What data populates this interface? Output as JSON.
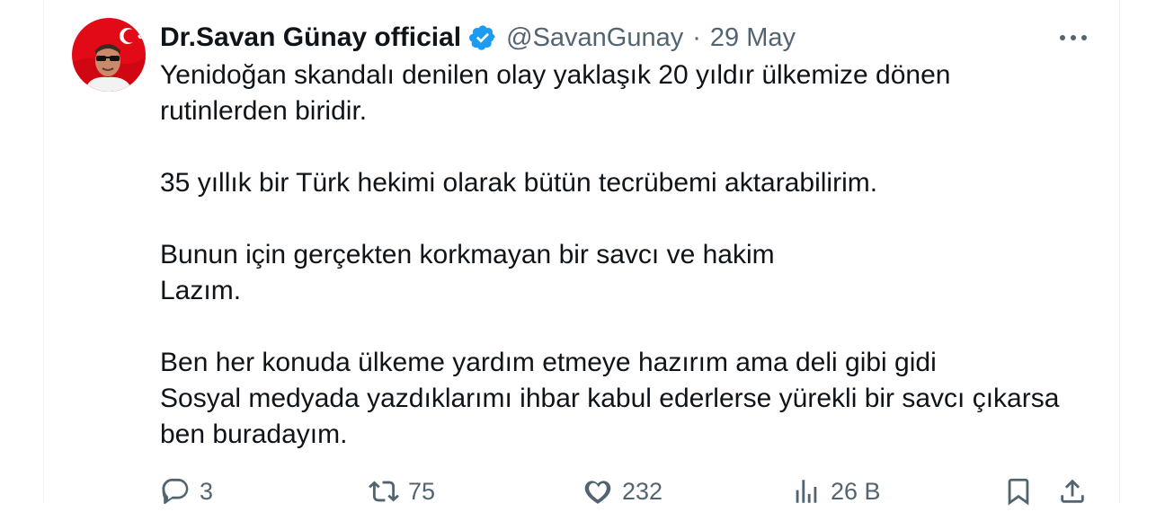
{
  "author": {
    "display_name": "Dr.Savan Günay official",
    "handle": "@SavanGunay",
    "date": "29 May",
    "verified": true,
    "verified_color": "#1d9bf0"
  },
  "tweet": {
    "lines": [
      "Yenidoğan skandalı denilen olay yaklaşık 20 yıldır ülkemize dönen",
      "rutinlerden biridir.",
      "35 yıllık bir Türk hekimi olarak bütün tecrübemi aktarabilirim.",
      "Bunun için gerçekten korkmayan bir savcı ve hakim",
      "Lazım.",
      "Ben her konuda ülkeme yardım etmeye hazırım ama deli gibi gidi",
      "Sosyal medyada yazdıklarımı ihbar kabul ederlerse yürekli bir savcı çıkarsa",
      "ben buradayım."
    ]
  },
  "actions": {
    "reply": {
      "icon": "reply-icon",
      "count": "3"
    },
    "retweet": {
      "icon": "retweet-icon",
      "count": "75"
    },
    "like": {
      "icon": "heart-icon",
      "count": "232"
    },
    "views": {
      "icon": "views-icon",
      "count": "26 B"
    },
    "bookmark": {
      "icon": "bookmark-icon"
    },
    "share": {
      "icon": "share-icon"
    }
  },
  "colors": {
    "text": "#0f1419",
    "secondary": "#536471",
    "flag_red": "#e30a17"
  }
}
